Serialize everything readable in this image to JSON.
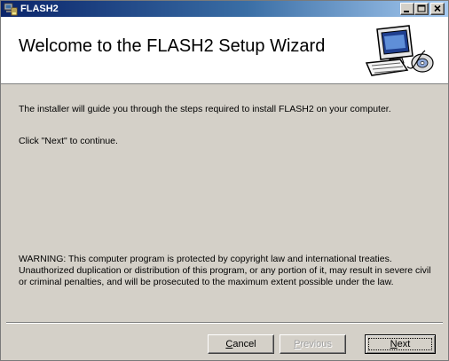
{
  "window": {
    "title": "FLASH2"
  },
  "header": {
    "heading": "Welcome to the FLASH2 Setup Wizard",
    "graphic_icon": "computer-setup-icon"
  },
  "content": {
    "intro": "The installer will guide you through the steps required to install FLASH2 on your computer.",
    "click_next": "Click \"Next\" to continue.",
    "warning": "WARNING: This computer program is protected by copyright law and international treaties. Unauthorized duplication or distribution of this program, or any portion of it, may result in severe civil or criminal penalties, and will be prosecuted to the maximum extent possible under the law."
  },
  "buttons": {
    "cancel_accel": "C",
    "cancel_rest": "ancel",
    "previous_accel": "P",
    "previous_rest": "revious",
    "next_accel": "N",
    "next_rest": "ext",
    "previous_enabled": false
  },
  "colors": {
    "titlebar_start": "#0a246a",
    "titlebar_end": "#a6caf0",
    "dialog_face": "#d4d0c8",
    "header_bg": "#ffffff"
  }
}
